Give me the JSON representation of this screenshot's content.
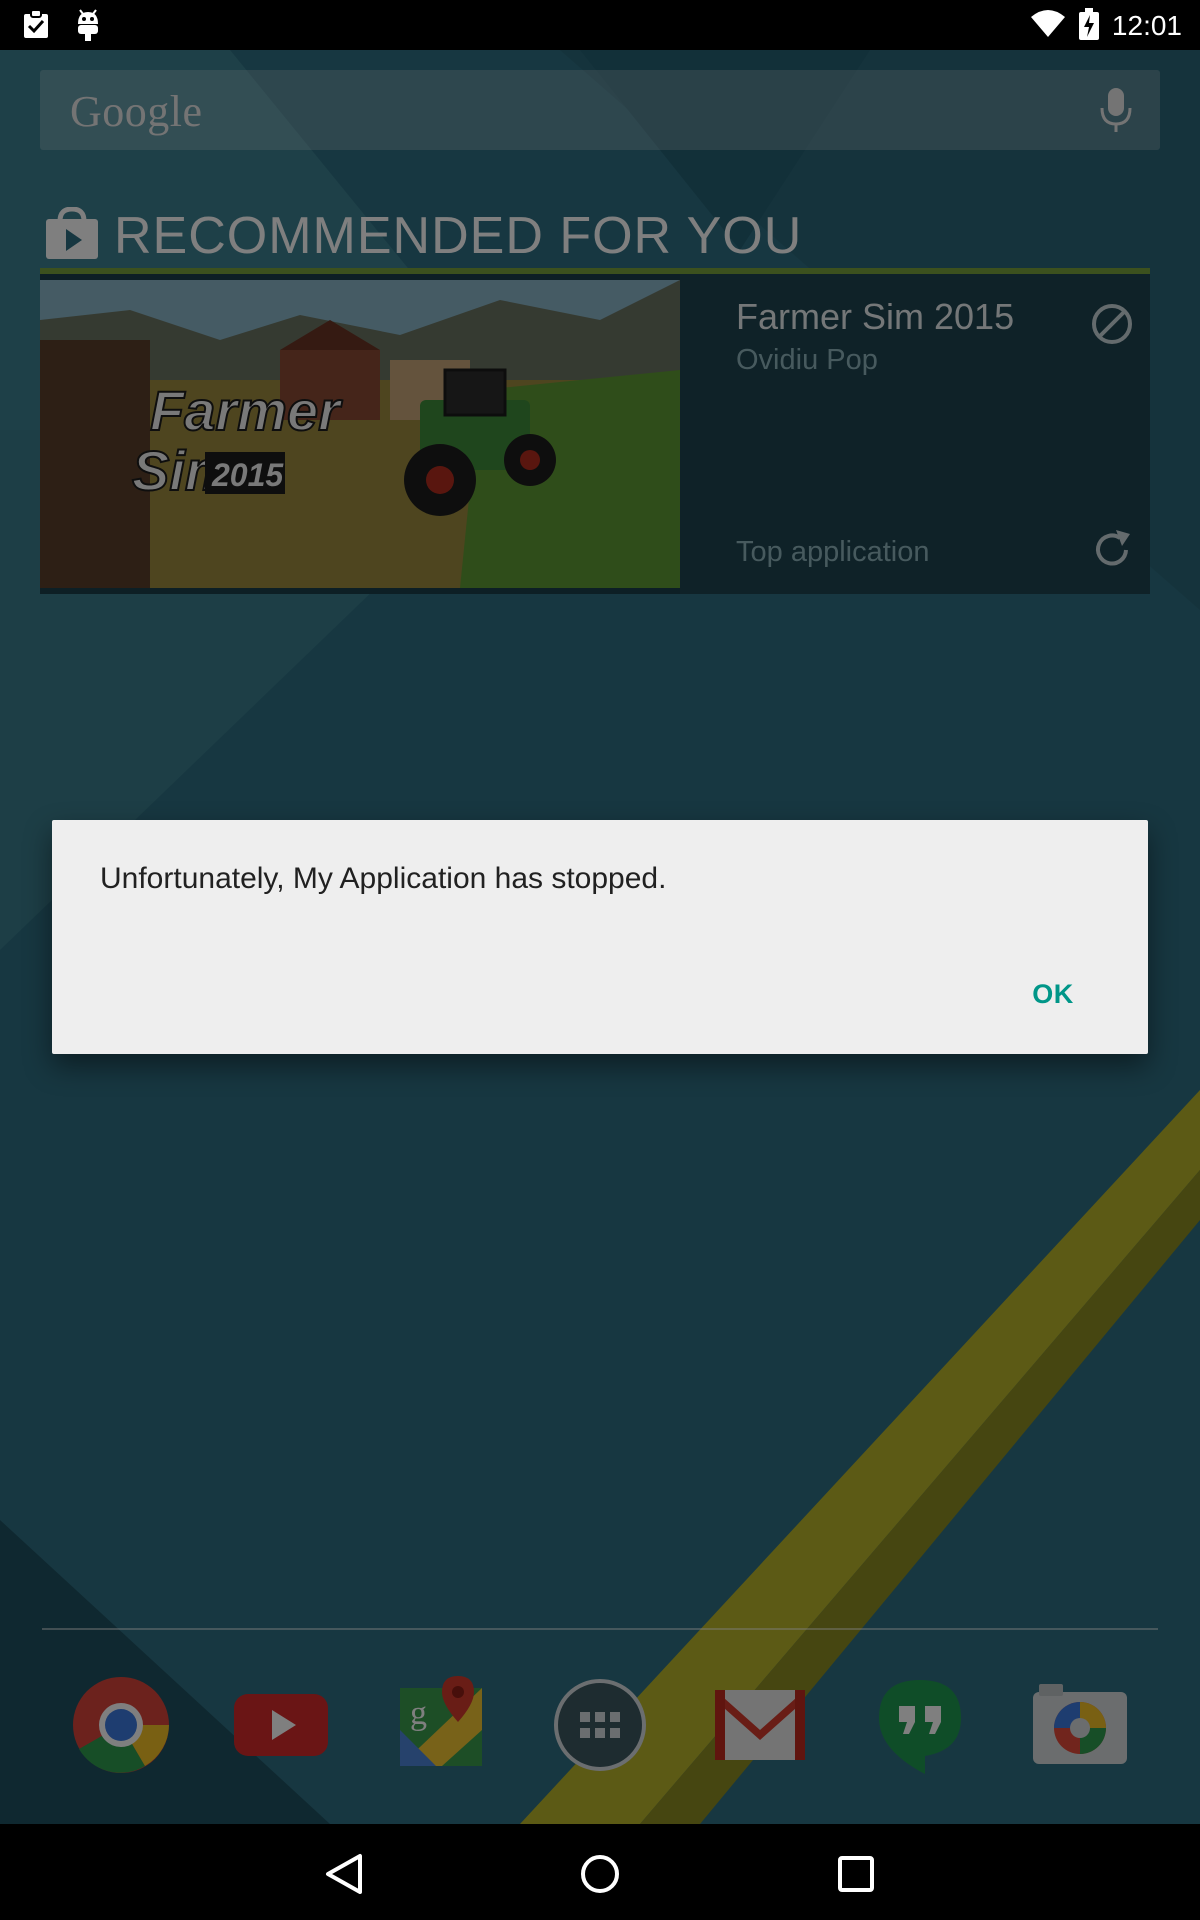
{
  "status_bar": {
    "time": "12:01",
    "icons": [
      "clipboard-check-icon",
      "android-debug-icon",
      "wifi-icon",
      "battery-charging-icon"
    ]
  },
  "search": {
    "logo_text": "Google",
    "mic_icon": "mic-icon"
  },
  "recommended": {
    "header": "RECOMMENDED FOR YOU",
    "header_icon": "play-store-bag-icon",
    "app": {
      "title": "Farmer Sim 2015",
      "developer": "Ovidiu Pop",
      "tag": "Top application",
      "image_title_line1": "Farmer",
      "image_title_line2": "Sim",
      "image_year": "2015"
    }
  },
  "dialog": {
    "message": "Unfortunately, My Application has stopped.",
    "ok_label": "OK"
  },
  "dock": {
    "apps": [
      "chrome-icon",
      "youtube-icon",
      "maps-icon",
      "app-drawer-icon",
      "gmail-icon",
      "hangouts-icon",
      "camera-icon"
    ]
  },
  "nav": {
    "buttons": [
      "back-icon",
      "home-icon",
      "recents-icon"
    ]
  },
  "colors": {
    "dialog_accent": "#009688",
    "wallpaper": "#2f6f82",
    "card_border": "#79a33c"
  }
}
